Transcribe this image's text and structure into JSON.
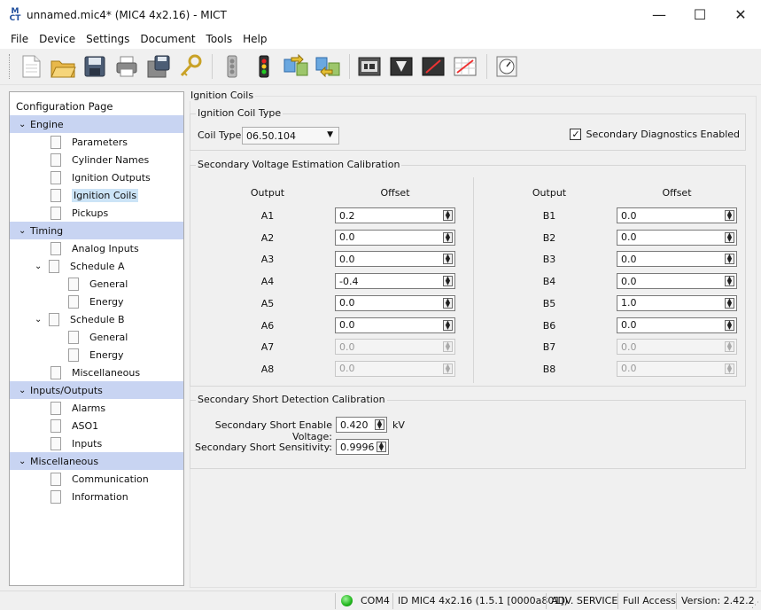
{
  "window": {
    "title": "unnamed.mic4* (MIC4 4x2.16) - MICT",
    "controls": {
      "minimize": "—",
      "maximize": "☐",
      "close": "✕"
    }
  },
  "menu": [
    "File",
    "Device",
    "Settings",
    "Document",
    "Tools",
    "Help"
  ],
  "toolbar": [
    "new-doc-icon",
    "open-folder-icon",
    "save-icon",
    "print-icon",
    "save-device-icon",
    "key-icon",
    "disconnected-icon",
    "connected-icon",
    "upload-icon",
    "download-icon",
    "monitor-icon",
    "terminal-icon",
    "oscilloscope-icon",
    "chart-icon",
    "gauge-icon"
  ],
  "tree": {
    "header": "Configuration Page",
    "items": [
      {
        "type": "category",
        "label": "Engine"
      },
      {
        "type": "leaf",
        "label": "Parameters",
        "indent": 1
      },
      {
        "type": "leaf",
        "label": "Cylinder Names",
        "indent": 1
      },
      {
        "type": "leaf",
        "label": "Ignition Outputs",
        "indent": 1
      },
      {
        "type": "leaf",
        "label": "Ignition Coils",
        "indent": 1,
        "selected": true
      },
      {
        "type": "leaf",
        "label": "Pickups",
        "indent": 1
      },
      {
        "type": "category",
        "label": "Timing"
      },
      {
        "type": "leaf",
        "label": "Analog Inputs",
        "indent": 1
      },
      {
        "type": "folder",
        "label": "Schedule A",
        "indent": 1
      },
      {
        "type": "leaf",
        "label": "General",
        "indent": 2
      },
      {
        "type": "leaf",
        "label": "Energy",
        "indent": 2
      },
      {
        "type": "folder",
        "label": "Schedule B",
        "indent": 1
      },
      {
        "type": "leaf",
        "label": "General",
        "indent": 2
      },
      {
        "type": "leaf",
        "label": "Energy",
        "indent": 2
      },
      {
        "type": "leaf",
        "label": "Miscellaneous",
        "indent": 1
      },
      {
        "type": "category",
        "label": "Inputs/Outputs"
      },
      {
        "type": "leaf",
        "label": "Alarms",
        "indent": 1
      },
      {
        "type": "leaf",
        "label": "ASO1",
        "indent": 1
      },
      {
        "type": "leaf",
        "label": "Inputs",
        "indent": 1
      },
      {
        "type": "category",
        "label": "Miscellaneous"
      },
      {
        "type": "leaf",
        "label": "Communication",
        "indent": 1
      },
      {
        "type": "leaf",
        "label": "Information",
        "indent": 1
      }
    ]
  },
  "page": {
    "group_title": "Ignition Coils",
    "coil_type": {
      "group_title": "Ignition Coil Type",
      "label": "Coil Type:",
      "value": "06.50.104",
      "secondary_diag_label": "Secondary Diagnostics Enabled",
      "secondary_diag_checked": true
    },
    "voltage_calib": {
      "group_title": "Secondary Voltage Estimation Calibration",
      "col_output": "Output",
      "col_offset": "Offset",
      "left": [
        {
          "output": "A1",
          "offset": "0.2",
          "enabled": true
        },
        {
          "output": "A2",
          "offset": "0.0",
          "enabled": true
        },
        {
          "output": "A3",
          "offset": "0.0",
          "enabled": true
        },
        {
          "output": "A4",
          "offset": "-0.4",
          "enabled": true
        },
        {
          "output": "A5",
          "offset": "0.0",
          "enabled": true
        },
        {
          "output": "A6",
          "offset": "0.0",
          "enabled": true
        },
        {
          "output": "A7",
          "offset": "0.0",
          "enabled": false
        },
        {
          "output": "A8",
          "offset": "0.0",
          "enabled": false
        }
      ],
      "right": [
        {
          "output": "B1",
          "offset": "0.0",
          "enabled": true
        },
        {
          "output": "B2",
          "offset": "0.0",
          "enabled": true
        },
        {
          "output": "B3",
          "offset": "0.0",
          "enabled": true
        },
        {
          "output": "B4",
          "offset": "0.0",
          "enabled": true
        },
        {
          "output": "B5",
          "offset": "1.0",
          "enabled": true
        },
        {
          "output": "B6",
          "offset": "0.0",
          "enabled": true
        },
        {
          "output": "B7",
          "offset": "0.0",
          "enabled": false
        },
        {
          "output": "B8",
          "offset": "0.0",
          "enabled": false
        }
      ]
    },
    "short_detect": {
      "group_title": "Secondary Short Detection Calibration",
      "enable_voltage_label": "Secondary Short Enable Voltage:",
      "enable_voltage_value": "0.420",
      "enable_voltage_unit": "kV",
      "sensitivity_label": "Secondary Short Sensitivity:",
      "sensitivity_value": "0.9996"
    }
  },
  "status": {
    "port": "COM4",
    "device_id": "ID MIC4 4x2.16 (1.5.1 [0000a801])",
    "mode": "ADV. SERVICE",
    "access": "Full Access",
    "version": "Version: 2.42.2"
  }
}
